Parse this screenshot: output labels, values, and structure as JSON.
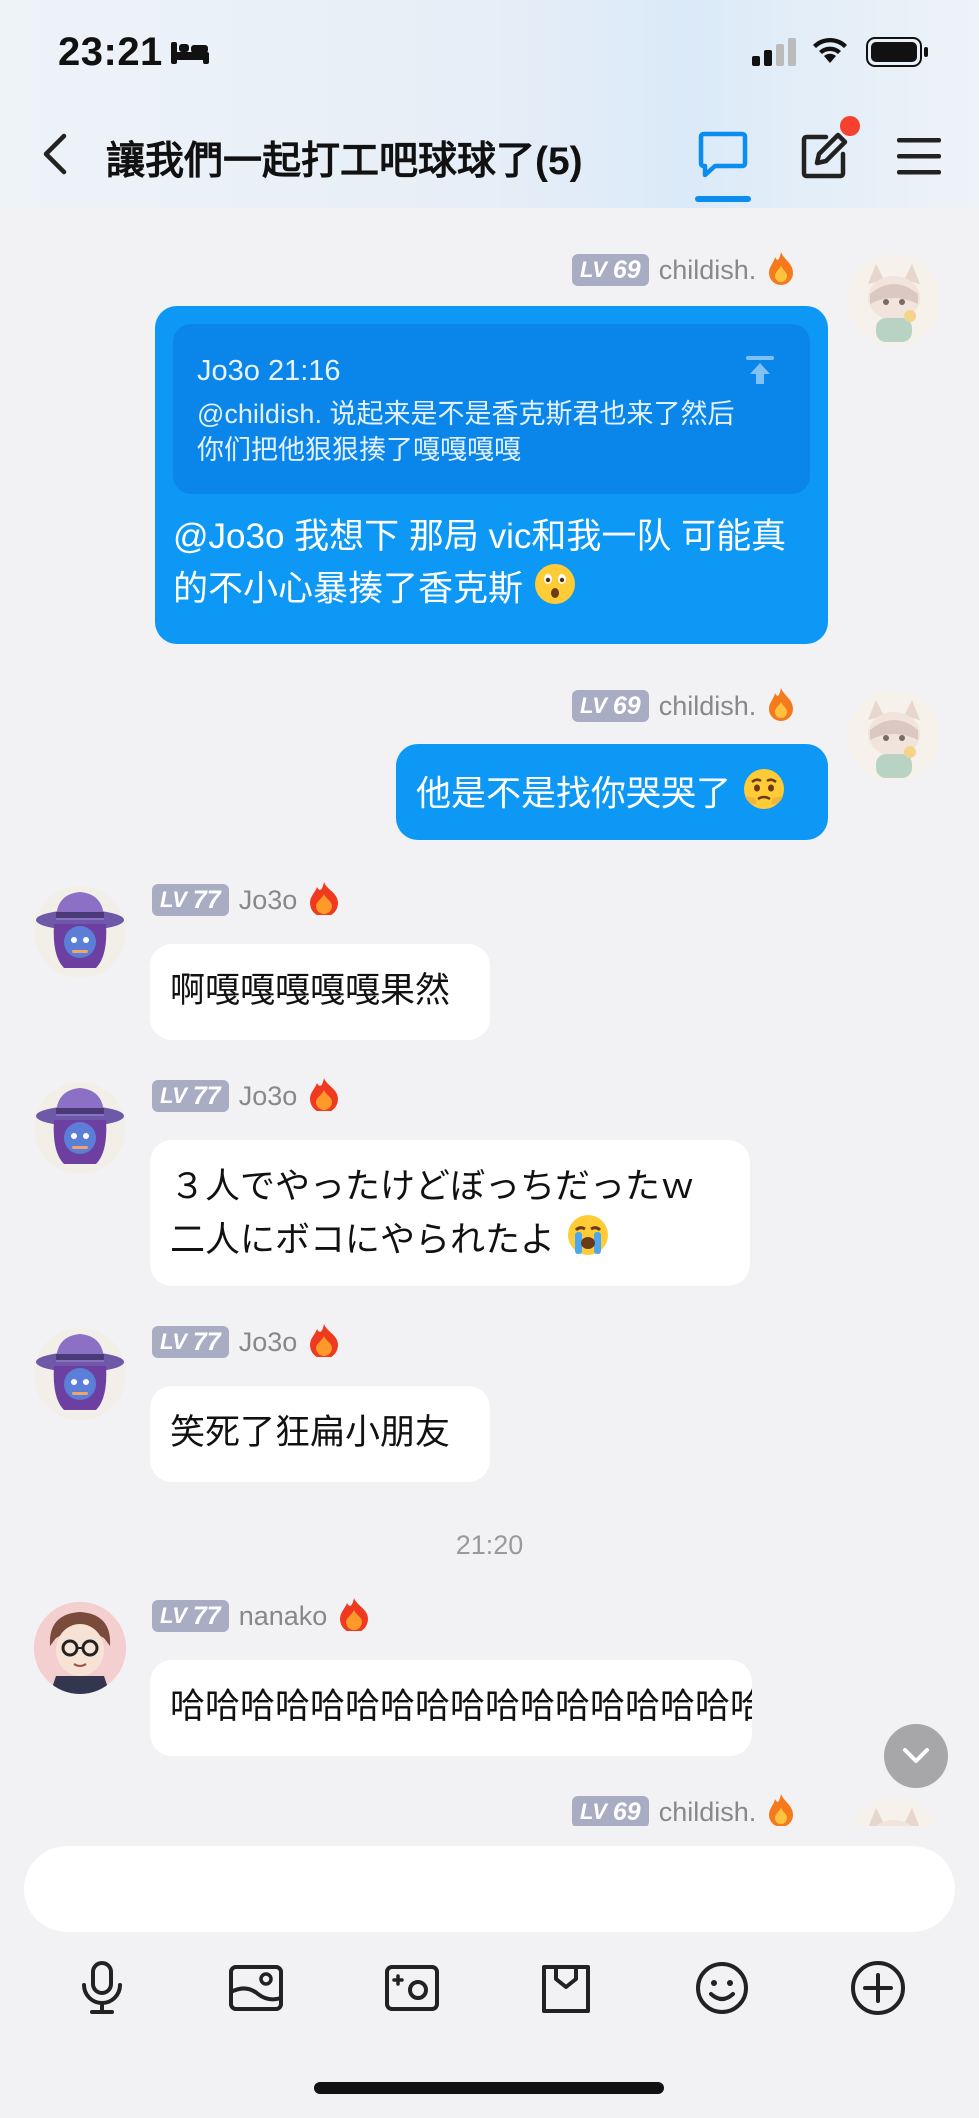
{
  "status": {
    "time": "23:21"
  },
  "header": {
    "title": "讓我們一起打工吧球球了(5)"
  },
  "messages": [
    {
      "sender": {
        "level_prefix": "LV",
        "level": "69",
        "name": "childish."
      },
      "quote": {
        "header": "Jo3o 21:16",
        "text": "@childish. 说起来是不是香克斯君也来了然后你们把他狠狠揍了嘎嘎嘎嘎"
      },
      "text": "@Jo3o 我想下 那局 vic和我一队 可能真的不小心暴揍了香克斯"
    },
    {
      "sender": {
        "level_prefix": "LV",
        "level": "69",
        "name": "childish."
      },
      "text": "他是不是找你哭哭了"
    },
    {
      "sender": {
        "level_prefix": "LV",
        "level": "77",
        "name": "Jo3o"
      },
      "text": "啊嘎嘎嘎嘎嘎果然"
    },
    {
      "sender": {
        "level_prefix": "LV",
        "level": "77",
        "name": "Jo3o"
      },
      "text_line1": "３人でやったけどぼっちだったｗ",
      "text_line2": "二人にボコにやられたよ"
    },
    {
      "sender": {
        "level_prefix": "LV",
        "level": "77",
        "name": "Jo3o"
      },
      "text": "笑死了狂扁小朋友"
    },
    {
      "timestamp": "21:20"
    },
    {
      "sender": {
        "level_prefix": "LV",
        "level": "77",
        "name": "nanako"
      },
      "text": "哈哈哈哈哈哈哈哈哈哈哈哈哈哈哈哈哈哈哈哈"
    },
    {
      "sender": {
        "level_prefix": "LV",
        "level": "69",
        "name": "childish."
      }
    }
  ],
  "composer": {
    "placeholder": "",
    "tools": [
      "microphone-icon",
      "image-icon",
      "photo-effects-icon",
      "sticker-icon",
      "emoji-icon",
      "plus-icon"
    ]
  },
  "colors": {
    "accent": "#0d98f6",
    "level_badge": "#a9adc4",
    "notification": "#f5412d"
  }
}
